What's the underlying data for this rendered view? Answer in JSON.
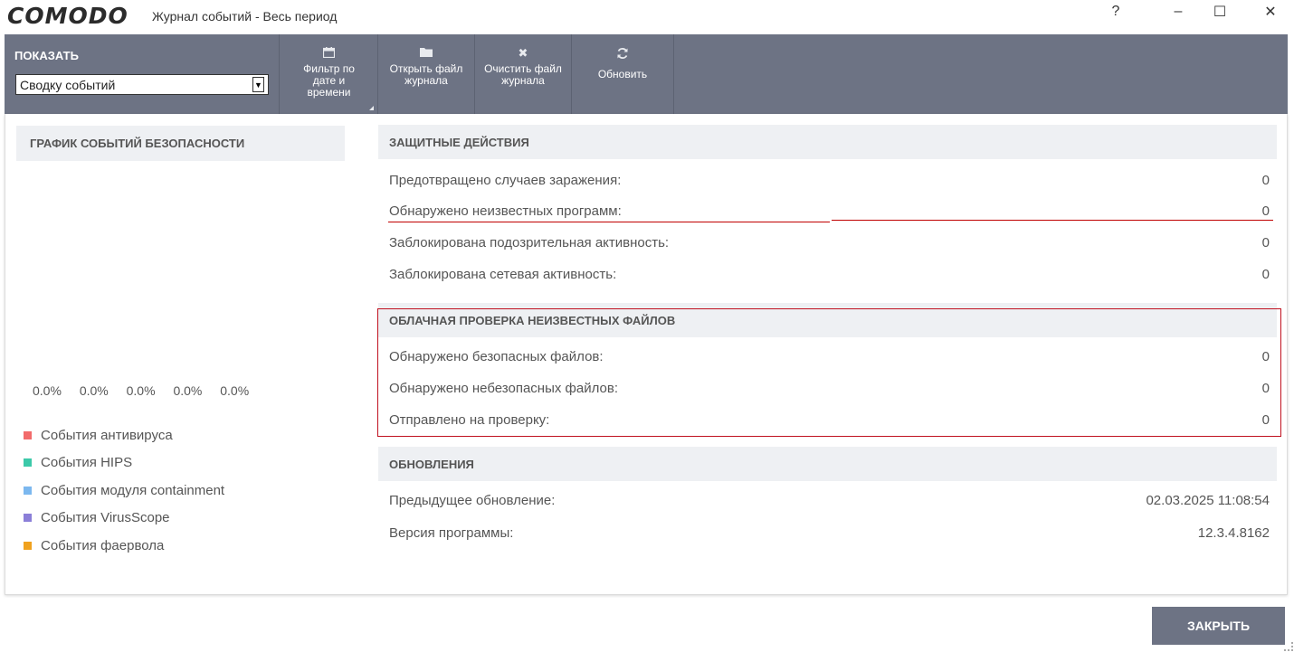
{
  "window": {
    "logo": "COMODO",
    "title": "Журнал событий - Весь период",
    "help": "?",
    "minimize": "–",
    "maximize": "☐",
    "close": "✕"
  },
  "toolbar": {
    "show_label": "ПОКАЗАТЬ",
    "show_select_value": "Сводку событий",
    "buttons": [
      {
        "icon": "calendar-icon",
        "label": "Фильтр по дате и времени"
      },
      {
        "icon": "folder-icon",
        "label": "Открыть файл журнала"
      },
      {
        "icon": "clear-icon",
        "label": "Очистить файл журнала"
      },
      {
        "icon": "refresh-icon",
        "label": "Обновить"
      }
    ]
  },
  "chart": {
    "title": "ГРАФИК СОБЫТИЙ БЕЗОПАСНОСТИ",
    "percents": [
      "0.0%",
      "0.0%",
      "0.0%",
      "0.0%",
      "0.0%"
    ],
    "legend": [
      {
        "label": "События антивируса",
        "color": "#f26b6b"
      },
      {
        "label": "События HIPS",
        "color": "#3cc9a9"
      },
      {
        "label": "События модуля containment",
        "color": "#7cb8ef"
      },
      {
        "label": "События VirusScope",
        "color": "#8b7fd8"
      },
      {
        "label": "События фаервола",
        "color": "#f0a21f"
      }
    ]
  },
  "chart_data": {
    "type": "pie",
    "title": "ГРАФИК СОБЫТИЙ БЕЗОПАСНОСТИ",
    "categories": [
      "События антивируса",
      "События HIPS",
      "События модуля containment",
      "События VirusScope",
      "События фаервола"
    ],
    "values": [
      0.0,
      0.0,
      0.0,
      0.0,
      0.0
    ]
  },
  "protective": {
    "title": "ЗАЩИТНЫЕ ДЕЙСТВИЯ",
    "rows": [
      {
        "label": "Предотвращено случаев заражения:",
        "value": "0"
      },
      {
        "label": "Обнаружено неизвестных программ:",
        "value": "0"
      },
      {
        "label": "Заблокирована подозрительная активность:",
        "value": "0"
      },
      {
        "label": "Заблокирована сетевая активность:",
        "value": "0"
      }
    ]
  },
  "cloud": {
    "title": "ОБЛАЧНАЯ ПРОВЕРКА НЕИЗВЕСТНЫХ ФАЙЛОВ",
    "rows": [
      {
        "label": "Обнаружено безопасных файлов:",
        "value": "0"
      },
      {
        "label": "Обнаружено небезопасных файлов:",
        "value": "0"
      },
      {
        "label": "Отправлено на проверку:",
        "value": "0"
      }
    ]
  },
  "updates": {
    "title": "ОБНОВЛЕНИЯ",
    "rows": [
      {
        "label": "Предыдущее обновление:",
        "value": "02.03.2025 11:08:54"
      },
      {
        "label": "Версия программы:",
        "value": "12.3.4.8162"
      }
    ]
  },
  "footer": {
    "close_label": "ЗАКРЫТЬ"
  }
}
